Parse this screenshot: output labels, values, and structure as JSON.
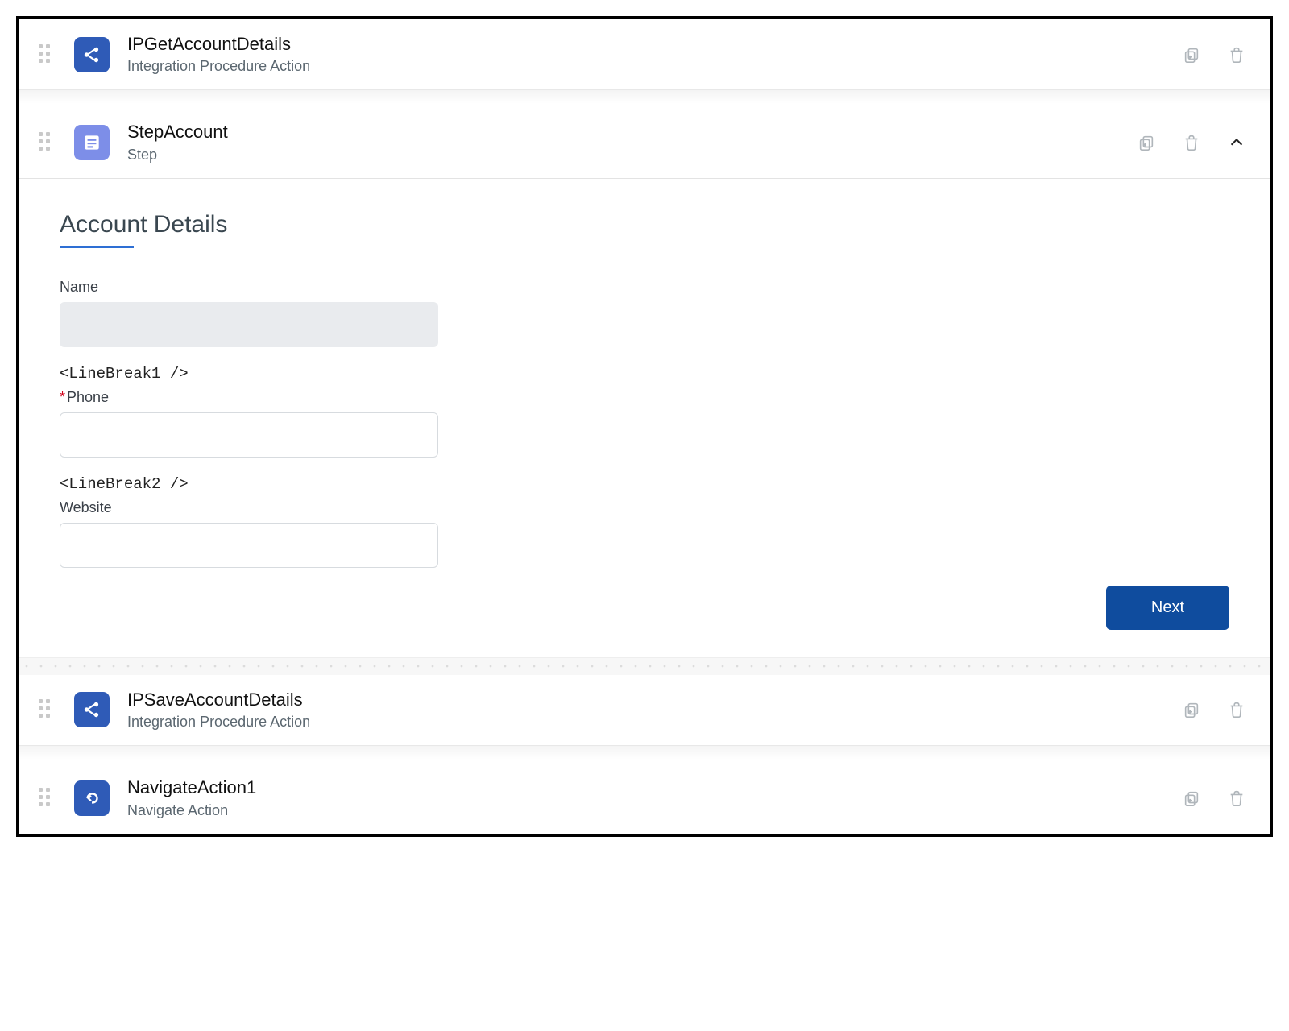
{
  "steps": [
    {
      "title": "IPGetAccountDetails",
      "subtitle": "Integration Procedure Action",
      "iconType": "ip",
      "iconName": "integration-procedure-icon",
      "expanded": false,
      "hasChevron": false
    },
    {
      "title": "StepAccount",
      "subtitle": "Step",
      "iconType": "step",
      "iconName": "step-icon",
      "expanded": true,
      "hasChevron": true
    },
    {
      "title": "IPSaveAccountDetails",
      "subtitle": "Integration Procedure Action",
      "iconType": "ip",
      "iconName": "integration-procedure-icon",
      "expanded": false,
      "hasChevron": false
    },
    {
      "title": "NavigateAction1",
      "subtitle": "Navigate Action",
      "iconType": "nav",
      "iconName": "navigate-action-icon",
      "expanded": false,
      "hasChevron": false
    }
  ],
  "panel": {
    "heading": "Account Details",
    "fields": {
      "name": {
        "label": "Name",
        "value": "",
        "disabled": true
      },
      "phone": {
        "label": "Phone",
        "value": "",
        "required": true
      },
      "website": {
        "label": "Website",
        "value": ""
      }
    },
    "linebreak1": "<LineBreak1 />",
    "linebreak2": "<LineBreak2 />",
    "nextLabel": "Next"
  }
}
